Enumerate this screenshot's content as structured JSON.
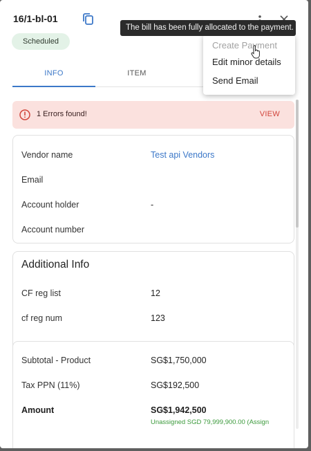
{
  "header": {
    "bill_id": "16/1-bl-01",
    "status": "Scheduled"
  },
  "tooltip": {
    "text": "The bill has been fully allocated to the payment."
  },
  "actions_menu": {
    "items": [
      {
        "label": "Create Payment",
        "disabled": true
      },
      {
        "label": "Edit minor details",
        "disabled": false
      },
      {
        "label": "Send Email",
        "disabled": false
      }
    ]
  },
  "tabs": [
    {
      "label": "INFO",
      "active": true
    },
    {
      "label": "ITEM",
      "active": false
    }
  ],
  "alert": {
    "message": "1 Errors found!",
    "action": "VIEW"
  },
  "vendor_card": {
    "rows": [
      {
        "label": "Vendor name",
        "value": "Test api Vendors"
      },
      {
        "label": "Email",
        "value": ""
      },
      {
        "label": "Account holder",
        "value": "-"
      },
      {
        "label": "Account number",
        "value": ""
      }
    ]
  },
  "additional_info": {
    "title": "Additional Info",
    "rows": [
      {
        "label": "CF reg list",
        "value": "12"
      },
      {
        "label": "cf reg num",
        "value": "123"
      }
    ]
  },
  "totals": {
    "rows": [
      {
        "label": "Subtotal - Product",
        "value": "SG$1,750,000"
      },
      {
        "label": "Tax PPN (11%)",
        "value": "SG$192,500"
      },
      {
        "label": "Amount",
        "value": "SG$1,942,500"
      }
    ],
    "unassigned_note": "Unassigned SGD 79,999,900.00 (Assign"
  },
  "colors": {
    "accent": "#3c78c8",
    "alert_bg": "#fbe1de",
    "alert_accent": "#d1453b",
    "badge_bg": "#e3f2e7",
    "note_green": "#3c9a3c"
  }
}
